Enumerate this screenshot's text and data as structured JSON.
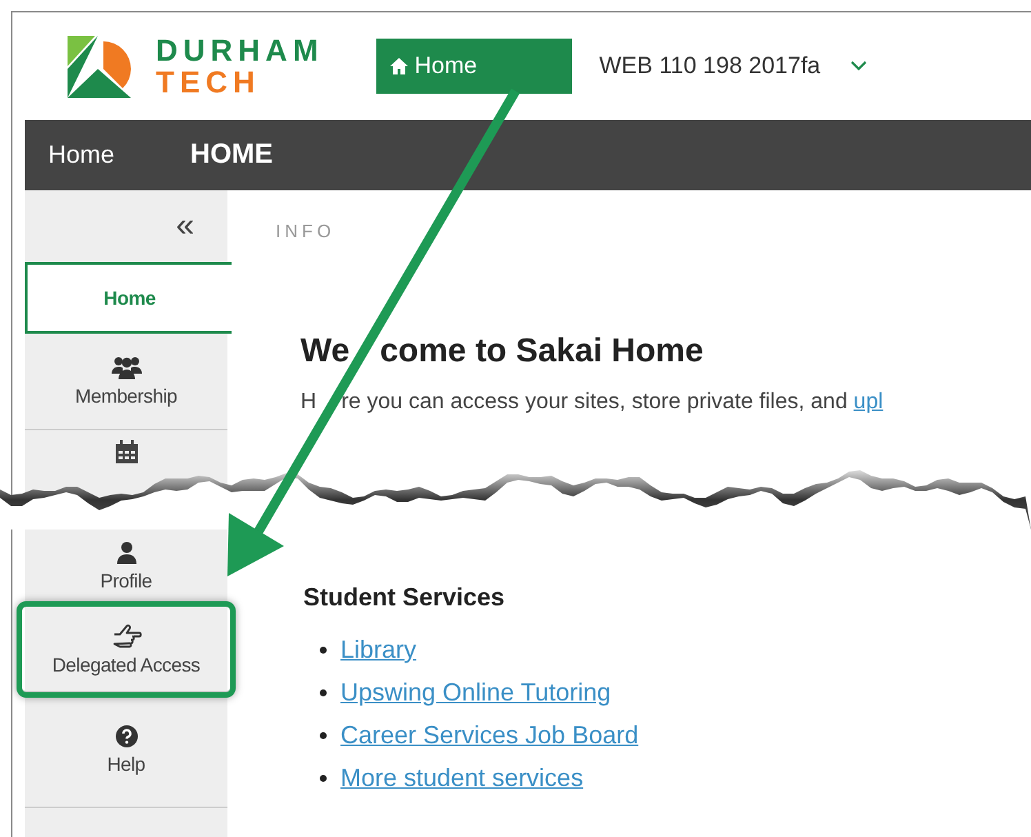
{
  "header": {
    "logo": {
      "line_1": "DURHAM",
      "line_2": "TECH"
    },
    "home_button": "Home",
    "site_name": "WEB 110 198 2017fa"
  },
  "toolbar": {
    "section": "Home",
    "page_title": "HOME"
  },
  "sidebar": {
    "collapse": "«",
    "items": [
      {
        "kind": "home",
        "label": "Home",
        "selected": true,
        "highlighted": false
      },
      {
        "kind": "members",
        "label": "Membership",
        "selected": false,
        "highlighted": false
      },
      {
        "kind": "calendar",
        "selected": false,
        "highlighted": false
      },
      {
        "kind": "profile",
        "label": "Profile",
        "selected": false,
        "highlighted": false
      },
      {
        "kind": "delegated",
        "label": "Delegated Access",
        "selected": false,
        "highlighted": true
      },
      {
        "kind": "help",
        "label": "Help",
        "selected": false,
        "highlighted": false
      }
    ]
  },
  "main": {
    "label": "INFO",
    "heading": {
      "before_arrow": "We",
      "after_arrow": "come to Sakai Home"
    },
    "intro": {
      "before_arrow": "H",
      "after_arrow": "re you can access your sites, store private files, and ",
      "link": "upl"
    },
    "section_title": "Student Services",
    "links": [
      "Library",
      "Upswing Online Tutoring",
      "Career Services Job Board",
      "More student services"
    ]
  }
}
